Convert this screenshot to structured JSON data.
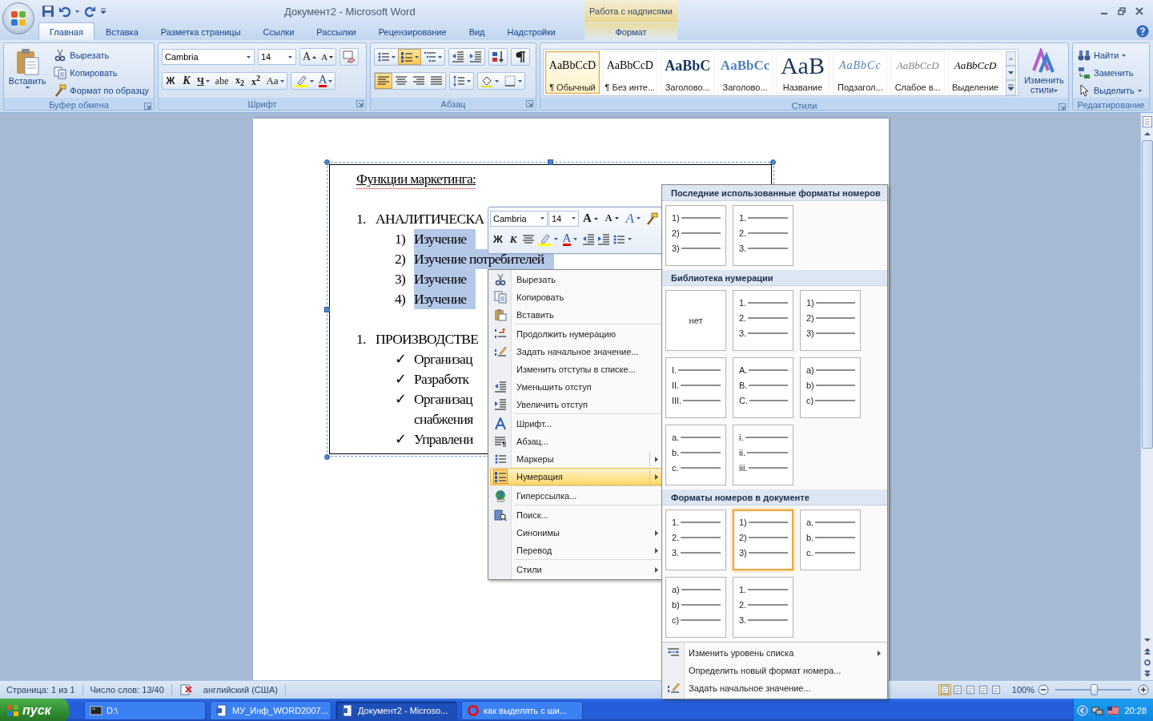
{
  "window": {
    "title": "Документ2 - Microsoft Word",
    "context_group": "Работа с надписями"
  },
  "tabs": [
    {
      "label": "Главная",
      "kind": "standard",
      "selected": true
    },
    {
      "label": "Вставка",
      "kind": "standard",
      "selected": false
    },
    {
      "label": "Разметка страницы",
      "kind": "standard",
      "selected": false
    },
    {
      "label": "Ссылки",
      "kind": "standard",
      "selected": false
    },
    {
      "label": "Рассылки",
      "kind": "standard",
      "selected": false
    },
    {
      "label": "Рецензирование",
      "kind": "standard",
      "selected": false
    },
    {
      "label": "Вид",
      "kind": "standard",
      "selected": false
    },
    {
      "label": "Надстройки",
      "kind": "standard",
      "selected": false
    },
    {
      "label": "Формат",
      "kind": "contextual",
      "selected": false
    }
  ],
  "ribbon": {
    "clipboard": {
      "label": "Буфер обмена",
      "paste": "Вставить",
      "commands": [
        "Вырезать",
        "Копировать",
        "Формат по образцу"
      ]
    },
    "font": {
      "label": "Шрифт",
      "font_name": "Cambria",
      "font_size": "14",
      "grow": "A",
      "shrink": "A",
      "format_buttons": [
        "Ж",
        "К",
        "Ч",
        "abe",
        "x$_{2}$",
        "x$^{2}$",
        "Aa"
      ],
      "font_color": "A"
    },
    "paragraph": {
      "label": "Абзац",
      "rows": [
        [
          [
            {
              "kind": "bullets",
              "selected": false
            },
            {
              "kind": "numbering",
              "selected": true
            },
            {
              "kind": "multilevel",
              "selected": false
            }
          ],
          [
            {
              "kind": "outdent",
              "selected": false
            },
            {
              "kind": "indent",
              "selected": false
            }
          ],
          [
            {
              "kind": "sort",
              "selected": false
            }
          ],
          [
            {
              "kind": "pilcrow",
              "selected": false
            }
          ]
        ],
        [
          [
            {
              "kind": "align-left",
              "selected": true
            },
            {
              "kind": "align-center",
              "selected": false
            },
            {
              "kind": "align-right",
              "selected": false
            },
            {
              "kind": "justify",
              "selected": false
            }
          ],
          [
            {
              "kind": "line-spacing",
              "selected": false
            }
          ],
          [
            {
              "kind": "shading",
              "selected": false
            },
            {
              "kind": "borders",
              "selected": false
            }
          ]
        ]
      ]
    },
    "styles": {
      "label": "Стили",
      "change_styles": "Изменить стили",
      "items": [
        {
          "preview": "AaBbCcD",
          "label": "¶ Обычный",
          "kind": "normal",
          "selected": true
        },
        {
          "preview": "AaBbCcD",
          "label": "¶ Без инте...",
          "kind": "normal",
          "selected": false
        },
        {
          "preview": "AaBbC",
          "label": "Заголово...",
          "kind": "heading1",
          "selected": false
        },
        {
          "preview": "AaBbCc",
          "label": "Заголово...",
          "kind": "heading2",
          "selected": false
        },
        {
          "preview": "AaB",
          "label": "Название",
          "kind": "title",
          "selected": false
        },
        {
          "preview": "AaBbCc",
          "label": "Подзагол...",
          "kind": "subtitle",
          "selected": false
        },
        {
          "preview": "AaBbCcD",
          "label": "Слабое в...",
          "kind": "subtle",
          "selected": false
        },
        {
          "preview": "AaBbCcD",
          "label": "Выделение",
          "kind": "emphasis",
          "selected": false
        }
      ]
    },
    "editing": {
      "label": "Редактирование",
      "commands": [
        "Найти",
        "Заменить",
        "Выделить"
      ]
    }
  },
  "document": {
    "title": "Функции маркетинга:",
    "sections": [
      {
        "number": "1.",
        "heading": "АНАЛИТИЧЕСКА",
        "items": [
          {
            "marker": "1)",
            "text": "Изучение",
            "selected": true
          },
          {
            "marker": "2)",
            "text": "Изучение потребителей",
            "selected": true
          },
          {
            "marker": "3)",
            "text": "Изучение",
            "selected": true
          },
          {
            "marker": "4)",
            "text": "Изучение",
            "selected": true
          }
        ]
      },
      {
        "number": "1.",
        "heading": "ПРОИЗВОДСТВЕ",
        "items": [
          {
            "marker": "✓",
            "text": "Организац",
            "selected": false
          },
          {
            "marker": "✓",
            "text": "Разработк",
            "selected": false
          },
          {
            "marker": "✓",
            "text": "Организац",
            "continuation": "снабжения",
            "selected": false
          },
          {
            "marker": "✓",
            "text": "Управлени",
            "selected": false
          }
        ]
      }
    ]
  },
  "mini_toolbar": {
    "font_name": "Cambria",
    "font_size": "14",
    "grow": "A",
    "shrink": "A",
    "styles": "A",
    "bold": "Ж",
    "italic": "К",
    "font_color": "A"
  },
  "context_menu": {
    "groups": [
      [
        {
          "label": "Вырезать",
          "submenu": false,
          "split": false,
          "selected": false
        },
        {
          "label": "Копировать",
          "submenu": false,
          "split": false,
          "selected": false
        },
        {
          "label": "Вставить",
          "submenu": false,
          "split": false,
          "selected": false
        }
      ],
      [
        {
          "label": "Продолжить нумерацию",
          "submenu": false,
          "split": false,
          "selected": false
        },
        {
          "label": "Задать начальное значение...",
          "submenu": false,
          "split": false,
          "selected": false
        },
        {
          "label": "Изменить отступы в списке...",
          "submenu": false,
          "split": false,
          "selected": false
        },
        {
          "label": "Уменьшить отступ",
          "submenu": false,
          "split": false,
          "selected": false
        },
        {
          "label": "Увеличить отступ",
          "submenu": false,
          "split": false,
          "selected": false
        }
      ],
      [
        {
          "label": "Шрифт...",
          "submenu": false,
          "split": false,
          "selected": false
        },
        {
          "label": "Абзац...",
          "submenu": false,
          "split": false,
          "selected": false
        },
        {
          "label": "Маркеры",
          "submenu": true,
          "split": true,
          "selected": false
        },
        {
          "label": "Нумерация",
          "submenu": true,
          "split": true,
          "selected": true
        }
      ],
      [
        {
          "label": "Гиперссылка...",
          "submenu": false,
          "split": false,
          "selected": false
        }
      ],
      [
        {
          "label": "Поиск...",
          "submenu": false,
          "split": false,
          "selected": false
        },
        {
          "label": "Синонимы",
          "submenu": true,
          "split": false,
          "selected": false
        },
        {
          "label": "Перевод",
          "submenu": true,
          "split": false,
          "selected": false
        }
      ],
      [
        {
          "label": "Стили",
          "submenu": true,
          "split": false,
          "selected": false
        }
      ]
    ]
  },
  "numbering_gallery": {
    "sections": [
      {
        "title": "Последние использованные форматы номеров",
        "formats": [
          {
            "kind": "list",
            "markers": [
              "1)",
              "2)",
              "3)"
            ],
            "selected": false
          },
          {
            "kind": "list",
            "markers": [
              "1.",
              "2.",
              "3."
            ],
            "selected": false
          }
        ]
      },
      {
        "title": "Библиотека нумерации",
        "formats": [
          {
            "kind": "none",
            "label": "нет",
            "selected": false
          },
          {
            "kind": "list",
            "markers": [
              "1.",
              "2.",
              "3."
            ],
            "selected": false
          },
          {
            "kind": "list",
            "markers": [
              "1)",
              "2)",
              "3)"
            ],
            "selected": false
          },
          {
            "kind": "list",
            "markers": [
              "I.",
              "II.",
              "III."
            ],
            "selected": false
          },
          {
            "kind": "list",
            "markers": [
              "A.",
              "B.",
              "C."
            ],
            "selected": false
          },
          {
            "kind": "list",
            "markers": [
              "a)",
              "b)",
              "c)"
            ],
            "selected": false
          },
          {
            "kind": "list",
            "markers": [
              "a.",
              "b.",
              "c."
            ],
            "selected": false
          },
          {
            "kind": "list",
            "markers": [
              "i.",
              "ii.",
              "iii."
            ],
            "selected": false
          }
        ]
      },
      {
        "title": "Форматы номеров в документе",
        "formats": [
          {
            "kind": "list",
            "markers": [
              "1.",
              "2.",
              "3."
            ],
            "selected": false
          },
          {
            "kind": "list",
            "markers": [
              "1)",
              "2)",
              "3)"
            ],
            "selected": true
          },
          {
            "kind": "list",
            "markers": [
              "a.",
              "b.",
              "c."
            ],
            "selected": false
          },
          {
            "kind": "list",
            "markers": [
              "a)",
              "b)",
              "c)"
            ],
            "selected": false
          },
          {
            "kind": "list",
            "markers": [
              "1.",
              "2.",
              "3."
            ],
            "selected": false
          }
        ]
      }
    ],
    "commands": [
      {
        "label": "Изменить уровень списка",
        "submenu": true
      },
      {
        "label": "Определить новый формат номера...",
        "submenu": false
      },
      {
        "label": "Задать начальное значение...",
        "submenu": false
      }
    ]
  },
  "status_bar": {
    "page": "Страница: 1 из 1",
    "words": "Число слов: 13/40",
    "language": "английский (США)",
    "views": [
      {
        "selected": true
      },
      {
        "selected": false
      },
      {
        "selected": false
      },
      {
        "selected": false
      },
      {
        "selected": false
      }
    ],
    "zoom": "100%",
    "zoom_slider": {
      "level": 0.5
    }
  },
  "taskbar": {
    "start": "пуск",
    "tasks": [
      {
        "label": "D:\\",
        "selected": false
      },
      {
        "label": "МУ_Инф_WORD2007...",
        "selected": false
      },
      {
        "label": "Документ2 - Microso...",
        "selected": true
      },
      {
        "label": "как выделять с ши...",
        "selected": false
      }
    ],
    "clock": "20:28"
  }
}
